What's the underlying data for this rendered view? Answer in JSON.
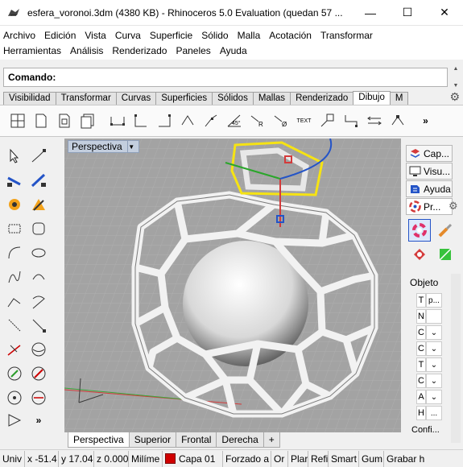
{
  "window": {
    "title": "esfera_voronoi.3dm (4380 KB) - Rhinoceros 5.0 Evaluation (quedan 57 ...",
    "minimize": "—",
    "maximize": "☐",
    "close": "✕"
  },
  "menu": {
    "row1": [
      "Archivo",
      "Edición",
      "Vista",
      "Curva",
      "Superficie",
      "Sólido",
      "Malla",
      "Acotación",
      "Transformar"
    ],
    "row2": [
      "Herramientas",
      "Análisis",
      "Renderizado",
      "Paneles",
      "Ayuda"
    ]
  },
  "command": {
    "label": "Comando:"
  },
  "toolbar_tabs": [
    "Visibilidad",
    "Transformar",
    "Curvas",
    "Superficies",
    "Sólidos",
    "Mallas",
    "Renderizado",
    "Dibujo",
    "M"
  ],
  "active_toolbar_tab": "Dibujo",
  "toolbar_text_label": "TEXT",
  "viewport": {
    "title": "Perspectiva"
  },
  "viewport_tabs": [
    "Perspectiva",
    "Superior",
    "Frontal",
    "Derecha",
    "+"
  ],
  "right_panel": {
    "tabs": [
      "Cap...",
      "Visu...",
      "Ayuda",
      "Pr..."
    ],
    "object_label": "Objeto",
    "prop_rows": [
      "T",
      "N",
      "C",
      "C",
      "T",
      "C",
      "A",
      "H"
    ],
    "prop_values": [
      "p...",
      "",
      "",
      "",
      "",
      "",
      "",
      "..."
    ],
    "more_label": "Confi..."
  },
  "status": {
    "units": "Univ",
    "x": "x -51.4",
    "y": "y 17.04",
    "z": "z 0.000",
    "unit_name": "Milíme",
    "layer": "Capa 01",
    "cells": [
      "Forzado a",
      "Or",
      "Plar",
      "Refi",
      "Smart",
      "Gum",
      "Grabar h"
    ]
  },
  "colors": {
    "viewport_bg": "#a3a3a3",
    "layer_swatch": "#d10000",
    "selection": "#f6e313"
  }
}
